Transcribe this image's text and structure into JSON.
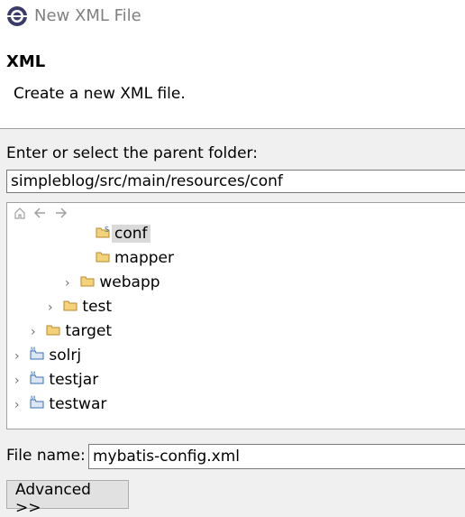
{
  "window": {
    "title": "New XML File",
    "icon": "eclipse-icon"
  },
  "header": {
    "title": "XML",
    "description": "Create a new XML file."
  },
  "parent_folder": {
    "label": "Enter or select the parent folder:",
    "value": "simpleblog/src/main/resources/conf"
  },
  "tree_toolbar": [
    "home-icon",
    "back-arrow-icon",
    "forward-arrow-icon"
  ],
  "tree": [
    {
      "label": "conf",
      "icon": "source-folder-icon",
      "expanded": false,
      "selected": true
    },
    {
      "label": "mapper",
      "icon": "folder-icon"
    },
    {
      "label": "webapp",
      "icon": "folder-icon",
      "collapsed": true
    },
    {
      "label": "test",
      "icon": "folder-icon",
      "collapsed": true
    },
    {
      "label": "target",
      "icon": "folder-icon",
      "collapsed": true
    },
    {
      "label": "solrj",
      "icon": "maven-project-icon",
      "collapsed": true
    },
    {
      "label": "testjar",
      "icon": "maven-project-icon",
      "collapsed": true
    },
    {
      "label": "testwar",
      "icon": "maven-project-icon",
      "collapsed": true
    }
  ],
  "file_name": {
    "label": "File name:",
    "value": "mybatis-config.xml"
  },
  "advanced_button": "Advanced >>",
  "colors": {
    "selection": "#d9d9d9",
    "folder": "#e8b64a",
    "project": "#3a6fb8"
  }
}
